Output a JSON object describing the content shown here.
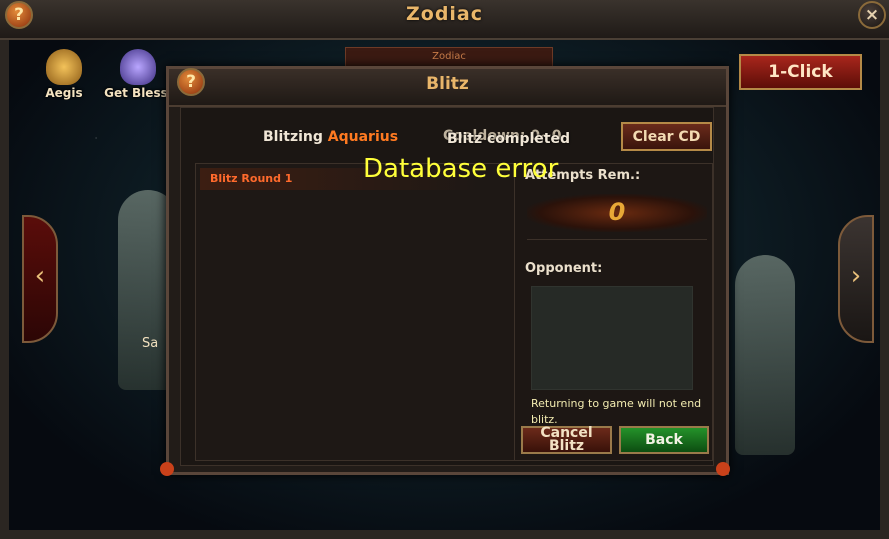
{
  "window": {
    "title": "Zodiac",
    "help_icon": "?",
    "close_icon": "×"
  },
  "top_tabs": [
    {
      "label": "Aegis",
      "icon": "aegis-winged-emblem"
    },
    {
      "label": "Get Blessi",
      "icon": "blessing-crystal-emblem"
    }
  ],
  "one_click_label": "1-Click",
  "behind_tab_text": "Zodiac",
  "partial_label": "Sa",
  "nav": {
    "left": "‹",
    "right": "›"
  },
  "blitz": {
    "title": "Blitz",
    "help_icon": "?",
    "blitzing_prefix": "Blitzing ",
    "zodiac": "Aquarius",
    "cooldown": "Cooldown: 0~0",
    "completed": "Blitz completed",
    "clear_cd": "Clear CD",
    "rounds": [
      "Blitz Round 1"
    ],
    "attempts_label": "Attempts Rem.:",
    "attempts_value": "0",
    "opponent_label": "Opponent:",
    "return_note": "Returning to game will not end blitz.",
    "cancel_label": "Cancel Blitz",
    "back_label": "Back"
  },
  "error_message": "Database error",
  "colors": {
    "accent_orange": "#ff7a21",
    "gold": "#e9b66a",
    "error_yellow": "#ffff3a",
    "back_green": "#24922a"
  }
}
